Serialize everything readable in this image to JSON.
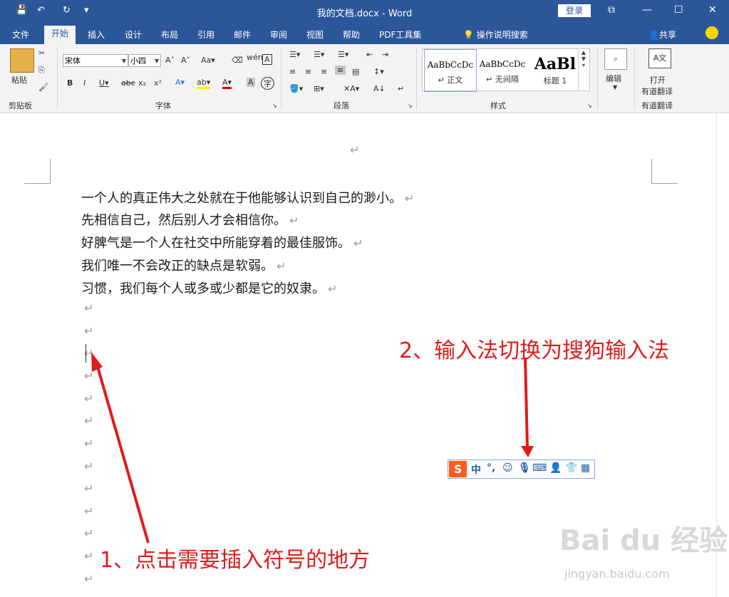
{
  "window": {
    "title": "我的文档.docx  -  Word",
    "login_label": "登录"
  },
  "tabs": [
    "文件",
    "开始",
    "插入",
    "设计",
    "布局",
    "引用",
    "邮件",
    "审阅",
    "视图",
    "帮助",
    "PDF工具集"
  ],
  "active_tab": "开始",
  "search_label": "操作说明搜索",
  "share_label": "共享",
  "ribbon": {
    "clipboard": {
      "paste_label": "粘贴",
      "group_label": "剪贴板"
    },
    "font": {
      "font_name": "宋体",
      "font_size": "小四",
      "group_label": "字体"
    },
    "paragraph": {
      "group_label": "段落"
    },
    "styles": {
      "group_label": "样式",
      "items": [
        {
          "sample": "AaBbCcDc",
          "name": "↵ 正文"
        },
        {
          "sample": "AaBbCcDc",
          "name": "↵ 无间隔"
        },
        {
          "sample": "AaBl",
          "name": "标题 1"
        }
      ]
    },
    "editing": {
      "label": "编辑"
    },
    "youdao": {
      "label1": "打开",
      "label2": "有道翻译",
      "group_label": "有道翻译"
    }
  },
  "document": {
    "lines": [
      "一个人的真正伟大之处就在于他能够认识到自己的渺小。",
      "先相信自己，然后别人才会相信你。",
      "好脾气是一个人在社交中所能穿着的最佳服饰。",
      "我们唯一不会改正的缺点是软弱。",
      "习惯，我们每个人或多或少都是它的奴隶。"
    ],
    "paragraph_mark": "↵"
  },
  "annotations": {
    "step1": "1、点击需要插入符号的地方",
    "step2": "2、输入法切换为搜狗输入法"
  },
  "ime": {
    "logo": "S",
    "mode": "中",
    "punct": "°,"
  },
  "watermark": {
    "main": "Bai du 经验",
    "sub": "jingyan.baidu.com"
  },
  "colors": {
    "titlebar": "#2b579a",
    "annotation": "#e01b1b",
    "ime_logo": "#ff5b1a"
  }
}
